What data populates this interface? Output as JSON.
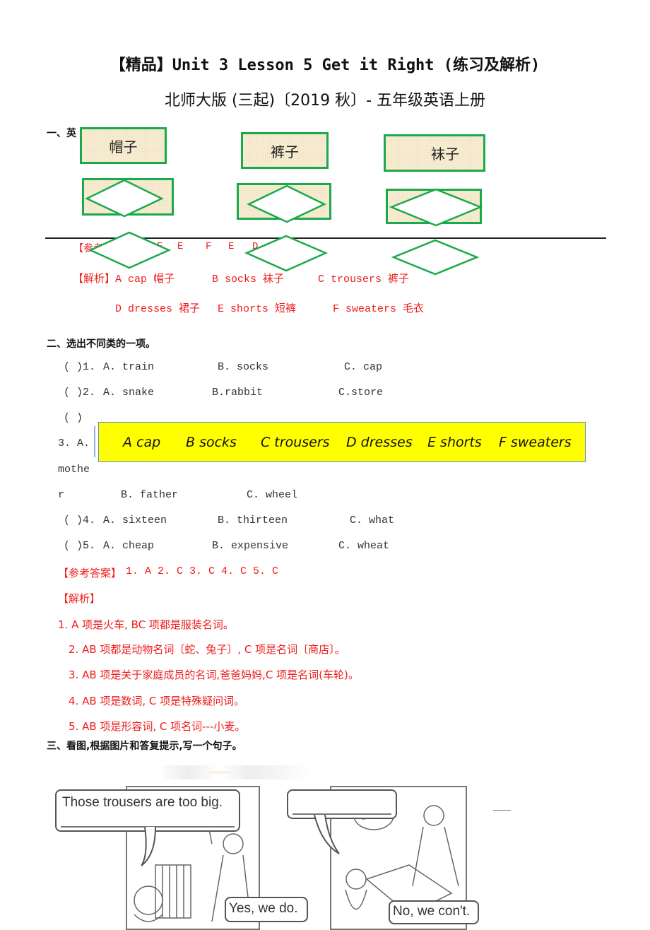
{
  "header": {
    "title": "【精品】Unit 3 Lesson 5 Get it Right (练习及解析)",
    "subtitle": "北师大版 (三起)〔2019 秋〕- 五年级英语上册"
  },
  "section1": {
    "heading": "一、英",
    "boxes": [
      {
        "label": "帽子"
      },
      {
        "label": "裤子"
      },
      {
        "label": "袜子"
      }
    ],
    "answer_prefix": "【参考",
    "answer_visible": [
      "F",
      "E",
      "F",
      "E",
      "D"
    ],
    "analysis_label": "【解析】",
    "analysis_row1": [
      {
        "text": "A cap 帽子"
      },
      {
        "text": "B socks 袜子"
      },
      {
        "text": "C  trousers 裤子"
      }
    ],
    "analysis_row2": [
      {
        "text": "D dresses  裙子"
      },
      {
        "text": "E shorts 短裤"
      },
      {
        "text": "F sweaters 毛衣"
      }
    ]
  },
  "options_banner": {
    "items": [
      "A cap",
      "B socks",
      "C trousers",
      "D dresses",
      "E shorts",
      "F sweaters"
    ],
    "color": "#ffff00"
  },
  "section2": {
    "heading": "二、选出不同类的一项。",
    "questions": [
      {
        "prefix": "(  )1.",
        "a": "A.  train",
        "b": "B.  socks",
        "c": "C.  cap"
      },
      {
        "prefix": "(  )2.",
        "a": "A.  snake",
        "b": "B.rabbit",
        "c": "C.store"
      },
      {
        "prefix": "(  )",
        "a_line1": "3.  A.",
        "a_line2": "mothe",
        "a_line3": "r",
        "b": "B.  father",
        "c": "C.  wheel"
      },
      {
        "prefix": "(  )4.",
        "a": "A.  sixteen",
        "b": "B.  thirteen",
        "c": "C.  what"
      },
      {
        "prefix": "(  )5.",
        "a": "A.  cheap",
        "b": "B.  expensive",
        "c": "C.  wheat"
      }
    ],
    "answer_label": "【参考答案】",
    "answers": "1. A   2. C   3. C   4. C   5. C",
    "analysis_label": "【解析】",
    "analysis": [
      "1. A 项是火车, BC 项都是服装名词。",
      "2. AB 项都是动物名词〔蛇、兔子〕, C 项是名词〔商店〕。",
      "3. AB 项是关于家庭成员的名词,爸爸妈妈,C 项是名词(车轮)。",
      "4. AB 项是数词, C 项是特殊疑问词。",
      "5. AB 项是形容词, C 项名词---小麦。"
    ]
  },
  "section3": {
    "heading": "三、看图,根据图片和答复提示,写一个句子。",
    "comic1": {
      "question": "Those trousers are too big.",
      "reply": "Yes, we do."
    },
    "comic2": {
      "question": "",
      "reply": "No, we con't."
    }
  },
  "colors": {
    "red": "#ee1c1c",
    "green": "#1aaa4b",
    "box_fill": "#f7ebd0"
  }
}
